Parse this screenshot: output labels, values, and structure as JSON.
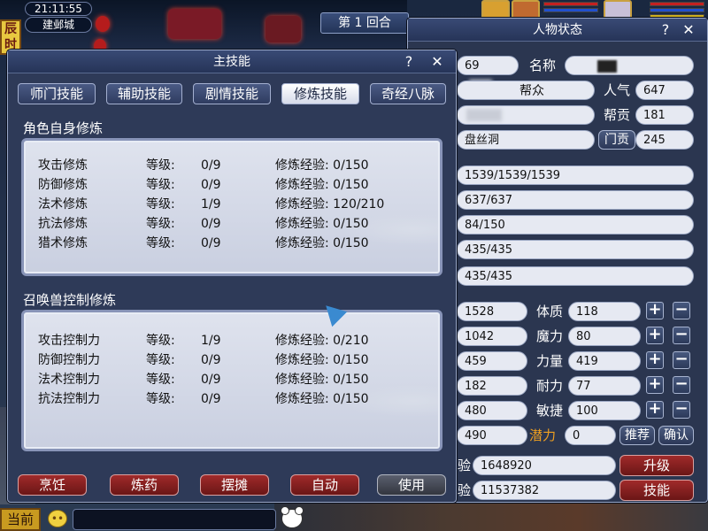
{
  "top": {
    "clock": "21:11:55",
    "map": "建邺城",
    "time_badge": "辰时",
    "round_label": "第 1 回合"
  },
  "status_panel": {
    "title": "人物状态",
    "help": "?",
    "close": "✕",
    "level": "69",
    "name_label": "名称",
    "gang_label": "帮众",
    "popularity_label": "人气",
    "popularity_value": "647",
    "contribution_label": "帮贡",
    "contribution_value": "181",
    "faction": "盘丝洞",
    "faction_contrib_label": "门贡",
    "faction_contrib_value": "245",
    "hp": "1539/1539/1539",
    "mp": "637/637",
    "anger": "84/150",
    "vitality": "435/435",
    "energy": "435/435",
    "stats": [
      {
        "value": "1528",
        "label": "体质",
        "attr": "118"
      },
      {
        "value": "1042",
        "label": "魔力",
        "attr": "80"
      },
      {
        "value": "459",
        "label": "力量",
        "attr": "419"
      },
      {
        "value": "182",
        "label": "耐力",
        "attr": "77"
      },
      {
        "value": "480",
        "label": "敏捷",
        "attr": "100"
      }
    ],
    "speed_value": "490",
    "potential_label": "潜力",
    "potential_value": "0",
    "recommend_btn": "推荐",
    "confirm_btn": "确认",
    "exp_label": "经验",
    "exp_value": "1648920",
    "exp2_label": "经验",
    "exp2_value": "11537382",
    "upgrade_btn": "升级",
    "skill_btn": "技能",
    "plus": "+",
    "minus": "−"
  },
  "skill_panel": {
    "title": "主技能",
    "help": "?",
    "close": "✕",
    "tabs": [
      "师门技能",
      "辅助技能",
      "剧情技能",
      "修炼技能",
      "奇经八脉"
    ],
    "active_tab": "修炼技能",
    "section1_title": "角色自身修炼",
    "level_label": "等级:",
    "exp_label": "修炼经验:",
    "self_cultivation": [
      {
        "name": "攻击修炼",
        "level": "0/9",
        "exp": "0/150"
      },
      {
        "name": "防御修炼",
        "level": "0/9",
        "exp": "0/150"
      },
      {
        "name": "法术修炼",
        "level": "1/9",
        "exp": "120/210"
      },
      {
        "name": "抗法修炼",
        "level": "0/9",
        "exp": "0/150"
      },
      {
        "name": "猎术修炼",
        "level": "0/9",
        "exp": "0/150"
      }
    ],
    "section2_title": "召唤兽控制修炼",
    "pet_cultivation": [
      {
        "name": "攻击控制力",
        "level": "1/9",
        "exp": "0/210"
      },
      {
        "name": "防御控制力",
        "level": "0/9",
        "exp": "0/150"
      },
      {
        "name": "法术控制力",
        "level": "0/9",
        "exp": "0/150"
      },
      {
        "name": "抗法控制力",
        "level": "0/9",
        "exp": "0/150"
      }
    ],
    "bottom_buttons": [
      "烹饪",
      "炼药",
      "摆摊",
      "自动",
      "使用"
    ]
  },
  "bottom_bar": {
    "channel": "当前"
  },
  "colors": {
    "panel_bg": "#2b3650",
    "title_bar": "#263458",
    "field_bg": "#e6e9f2",
    "red_button": "#8a2020",
    "orange_text": "#f0a020"
  }
}
